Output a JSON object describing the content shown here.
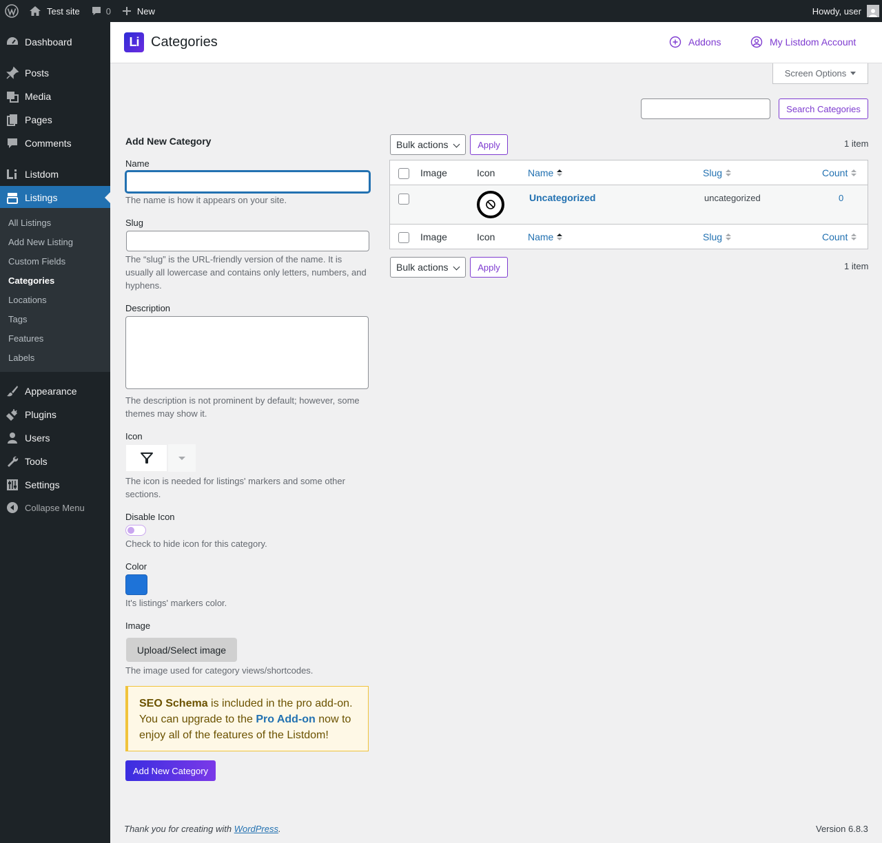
{
  "adminbar": {
    "site_name": "Test site",
    "comments_count": "0",
    "new_label": "New",
    "greeting": "Howdy, user"
  },
  "sidebar": {
    "items": [
      {
        "label": "Dashboard",
        "icon": "dashboard-icon"
      },
      {
        "label": "Posts",
        "icon": "pin-icon"
      },
      {
        "label": "Media",
        "icon": "media-icon"
      },
      {
        "label": "Pages",
        "icon": "pages-icon"
      },
      {
        "label": "Comments",
        "icon": "comment-icon"
      },
      {
        "label": "Listdom",
        "icon": "listdom-logo-icon"
      },
      {
        "label": "Listings",
        "icon": "listings-icon"
      },
      {
        "label": "Appearance",
        "icon": "brush-icon"
      },
      {
        "label": "Plugins",
        "icon": "plug-icon"
      },
      {
        "label": "Users",
        "icon": "user-icon"
      },
      {
        "label": "Tools",
        "icon": "wrench-icon"
      },
      {
        "label": "Settings",
        "icon": "sliders-icon"
      }
    ],
    "submenu": [
      "All Listings",
      "Add New Listing",
      "Custom Fields",
      "Categories",
      "Locations",
      "Tags",
      "Features",
      "Labels"
    ],
    "collapse_label": "Collapse Menu"
  },
  "header": {
    "title": "Categories",
    "logo_text": "Li",
    "addons_label": "Addons",
    "account_label": "My Listdom Account"
  },
  "screen_options_label": "Screen Options",
  "search": {
    "value": "",
    "button_label": "Search Categories"
  },
  "form": {
    "heading": "Add New Category",
    "name_label": "Name",
    "name_value": "",
    "name_desc": "The name is how it appears on your site.",
    "slug_label": "Slug",
    "slug_value": "",
    "slug_desc": "The “slug” is the URL-friendly version of the name. It is usually all lowercase and contains only letters, numbers, and hyphens.",
    "description_label": "Description",
    "description_value": "",
    "description_desc": "The description is not prominent by default; however, some themes may show it.",
    "icon_label": "Icon",
    "icon_value": "filter-icon",
    "icon_desc": "The icon is needed for listings' markers and some other sections.",
    "disable_icon_label": "Disable Icon",
    "disable_icon_checked": false,
    "disable_icon_desc": "Check to hide icon for this category.",
    "color_label": "Color",
    "color_value": "#1e73d8",
    "color_desc": "It's listings' markers color.",
    "image_label": "Image",
    "upload_label": "Upload/Select image",
    "image_desc": "The image used for category views/shortcodes.",
    "notice": {
      "strong": "SEO Schema",
      "text1": " is included in the pro add-on. You can upgrade to the ",
      "link": "Pro Add-on",
      "text2": " now to enjoy all of the features of the Listdom!"
    },
    "submit_label": "Add New Category"
  },
  "table": {
    "bulk_label": "Bulk actions",
    "apply_label": "Apply",
    "items_count": "1 item",
    "columns": [
      "Image",
      "Icon",
      "Name",
      "Slug",
      "Count"
    ],
    "rows": [
      {
        "name": "Uncategorized",
        "slug": "uncategorized",
        "count": "0",
        "icon": "ban-icon"
      }
    ]
  },
  "footer": {
    "thanks_prefix": "Thank you for creating with ",
    "thanks_link": "WordPress",
    "thanks_suffix": ".",
    "version": "Version 6.8.3"
  },
  "colors": {
    "accent": "#7e3bd0",
    "wp_blue": "#2271b1",
    "sidebar_bg": "#1d2327"
  }
}
